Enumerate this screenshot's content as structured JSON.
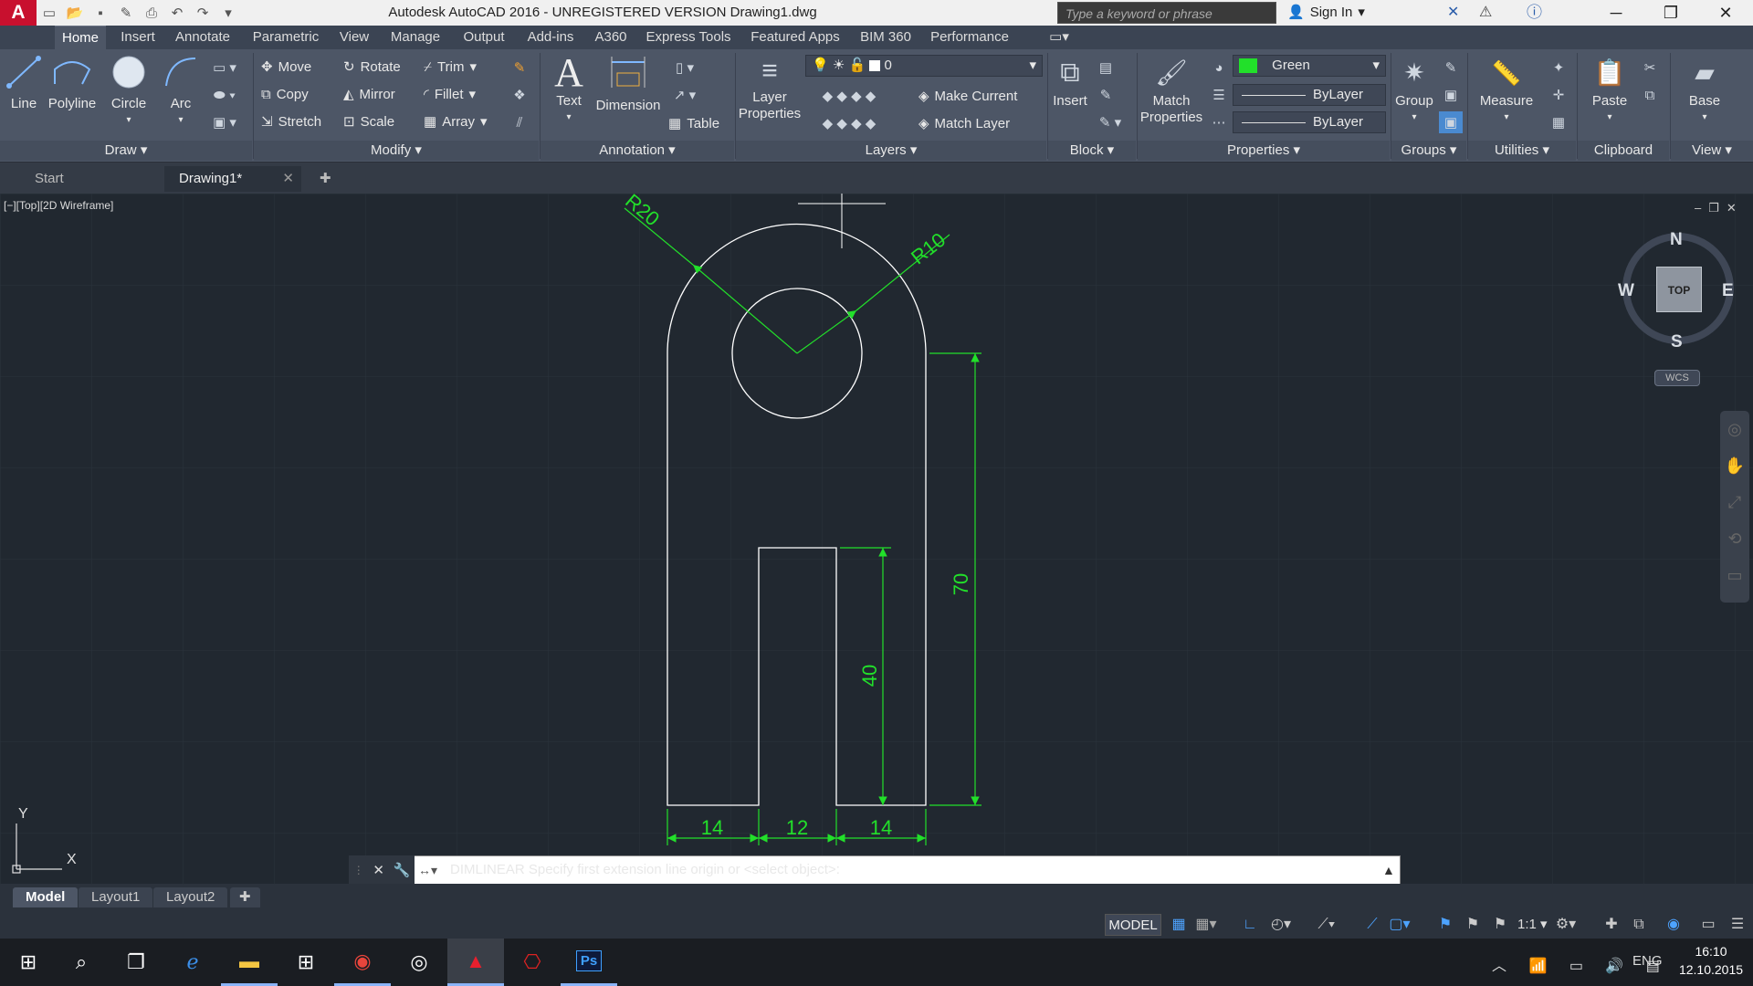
{
  "app": {
    "logo": "A",
    "title": "Autodesk AutoCAD 2016 - UNREGISTERED VERSION    Drawing1.dwg",
    "search_placeholder": "Type a keyword or phrase",
    "sign_in": "Sign In"
  },
  "ribbon_tabs": [
    "Home",
    "Insert",
    "Annotate",
    "Parametric",
    "View",
    "Manage",
    "Output",
    "Add-ins",
    "A360",
    "Express Tools",
    "Featured Apps",
    "BIM 360",
    "Performance"
  ],
  "draw": {
    "line": "Line",
    "polyline": "Polyline",
    "circle": "Circle",
    "arc": "Arc",
    "panel": "Draw"
  },
  "modify": {
    "move": "Move",
    "rotate": "Rotate",
    "trim": "Trim",
    "copy": "Copy",
    "mirror": "Mirror",
    "fillet": "Fillet",
    "stretch": "Stretch",
    "scale": "Scale",
    "array": "Array",
    "panel": "Modify"
  },
  "annotation": {
    "text": "Text",
    "dimension": "Dimension",
    "table": "Table",
    "panel": "Annotation"
  },
  "layers": {
    "layer_properties_1": "Layer",
    "layer_properties_2": "Properties",
    "current_layer": "0",
    "make_current": "Make Current",
    "match_layer": "Match Layer",
    "panel": "Layers"
  },
  "block": {
    "insert": "Insert",
    "panel": "Block"
  },
  "properties": {
    "match_1": "Match",
    "match_2": "Properties",
    "color": "Green",
    "color_hex": "#22e02a",
    "linetype": "ByLayer",
    "lineweight": "ByLayer",
    "panel": "Properties"
  },
  "groups": {
    "group": "Group",
    "panel": "Groups"
  },
  "utilities": {
    "measure": "Measure",
    "panel": "Utilities"
  },
  "clipboard": {
    "paste": "Paste",
    "panel": "Clipboard"
  },
  "view": {
    "base": "Base",
    "panel": "View"
  },
  "doc_tabs": {
    "start": "Start",
    "drawing": "Drawing1*"
  },
  "viewport_label": "[−][Top][2D Wireframe]",
  "viewcube": {
    "n": "N",
    "s": "S",
    "e": "E",
    "w": "W",
    "face": "TOP",
    "wcs": "WCS"
  },
  "dimensions": {
    "r20": "R20",
    "r10": "R10",
    "d70": "70",
    "d40": "40",
    "d14a": "14",
    "d12": "12",
    "d14b": "14"
  },
  "ucs": {
    "x": "X",
    "y": "Y"
  },
  "command": {
    "text": "DIMLINEAR Specify first extension line origin or <select object>:"
  },
  "layouts": [
    "Model",
    "Layout1",
    "Layout2"
  ],
  "status": {
    "model": "MODEL",
    "scale": "1:1"
  },
  "tray": {
    "lang": "ENG",
    "time": "16:10",
    "date": "12.10.2015"
  },
  "colors": {
    "drawing_bg": "#212830",
    "dim_green": "#22e02a",
    "geometry": "#ffffff",
    "ribbon": "#4d5666"
  }
}
